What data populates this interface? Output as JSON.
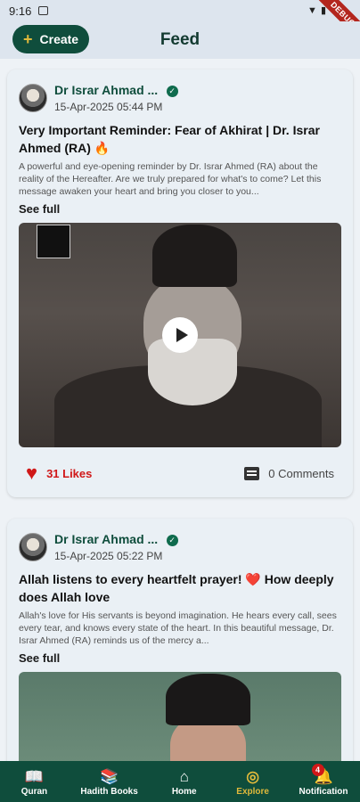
{
  "status": {
    "time": "9:16"
  },
  "debug_banner": "DEBUG",
  "appbar": {
    "create_label": "Create",
    "title": "Feed"
  },
  "posts": [
    {
      "author": "Dr Israr Ahmad ...",
      "date": "15-Apr-2025 05:44 PM",
      "title": "Very Important Reminder: Fear of Akhirat | Dr. Israr Ahmed (RA) 🔥",
      "description": "A powerful and eye-opening reminder by Dr. Israr Ahmed (RA) about the reality of the Hereafter. Are we truly prepared for what's to come? Let this message awaken your heart and bring you closer to you...",
      "see_full": "See full",
      "likes": "31 Likes",
      "comments": "0 Comments"
    },
    {
      "author": "Dr Israr Ahmad ...",
      "date": "15-Apr-2025 05:22 PM",
      "title": "Allah listens to every heartfelt prayer! ❤️ How deeply does Allah love",
      "description": "Allah's love for His servants is beyond imagination. He hears every call, sees every tear, and knows every state of the heart. In this beautiful message, Dr. Israr Ahmed (RA) reminds us of the mercy a...",
      "see_full": "See full"
    }
  ],
  "nav": [
    {
      "label": "Quran",
      "icon": "book-icon"
    },
    {
      "label": "Hadith Books",
      "icon": "books-icon"
    },
    {
      "label": "Home",
      "icon": "home-icon"
    },
    {
      "label": "Explore",
      "icon": "compass-icon",
      "active": true
    },
    {
      "label": "Notification",
      "icon": "bell-icon",
      "badge": "4"
    }
  ],
  "colors": {
    "primary": "#0f4d3c",
    "accent": "#e0b93b",
    "like": "#d01818"
  }
}
